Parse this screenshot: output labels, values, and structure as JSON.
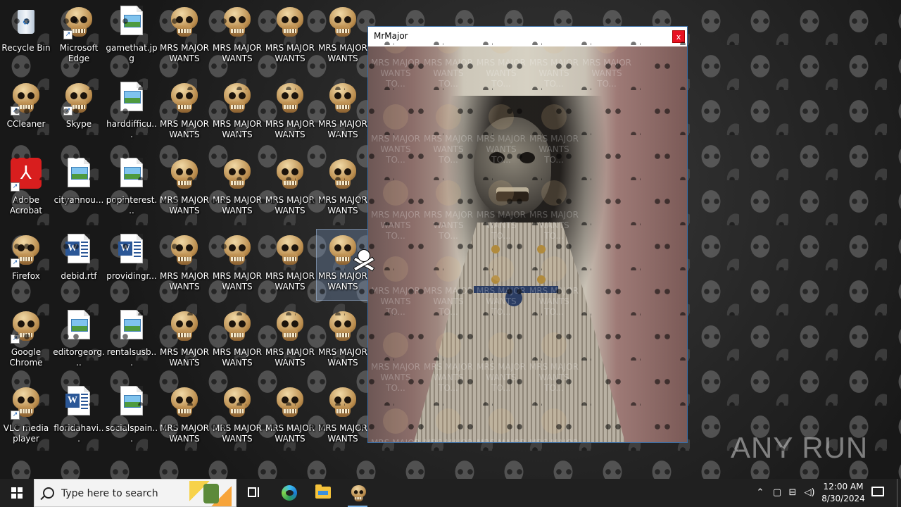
{
  "desktop": {
    "icons": [
      {
        "label": "Recycle Bin",
        "kind": "recycle",
        "shortcut": false
      },
      {
        "label": "Microsoft Edge",
        "kind": "skull",
        "shortcut": true
      },
      {
        "label": "gamethat.jpg",
        "kind": "image",
        "shortcut": false
      },
      {
        "label": "CCleaner",
        "kind": "skull",
        "shortcut": true
      },
      {
        "label": "Skype",
        "kind": "skull",
        "shortcut": true
      },
      {
        "label": "harddifficu...",
        "kind": "image",
        "shortcut": false
      },
      {
        "label": "Adobe Acrobat",
        "kind": "acrobat",
        "shortcut": true
      },
      {
        "label": "cityannou...",
        "kind": "image",
        "shortcut": false
      },
      {
        "label": "popinterest...",
        "kind": "image",
        "shortcut": false
      },
      {
        "label": "Firefox",
        "kind": "skull",
        "shortcut": true
      },
      {
        "label": "debid.rtf",
        "kind": "word",
        "shortcut": false
      },
      {
        "label": "providingr...",
        "kind": "word",
        "shortcut": false
      },
      {
        "label": "Google Chrome",
        "kind": "skull",
        "shortcut": true
      },
      {
        "label": "editorgeorg...",
        "kind": "image",
        "shortcut": false
      },
      {
        "label": "rentalsusb...",
        "kind": "image",
        "shortcut": false
      },
      {
        "label": "VLC media player",
        "kind": "skull",
        "shortcut": true
      },
      {
        "label": "floridahavi...",
        "kind": "word",
        "shortcut": false
      },
      {
        "label": "socialspain...",
        "kind": "image",
        "shortcut": false
      }
    ],
    "malware_icon_label": "MRS MAJOR WANTS TO...",
    "malware_rows": 6,
    "malware_cols": 4,
    "selected_malware_icon": {
      "row": 3,
      "col": 3
    }
  },
  "window": {
    "title": "MrMajor",
    "close_label": "x",
    "ghost_label": "MRS MAJOR WANTS TO..."
  },
  "watermark": "ANY RUN",
  "taskbar": {
    "search_placeholder": "Type here to search",
    "clock_time": "12:00 AM",
    "clock_date": "8/30/2024"
  },
  "colors": {
    "taskbar": "#202020",
    "close_button": "#e81123",
    "selection": "#7896be"
  }
}
